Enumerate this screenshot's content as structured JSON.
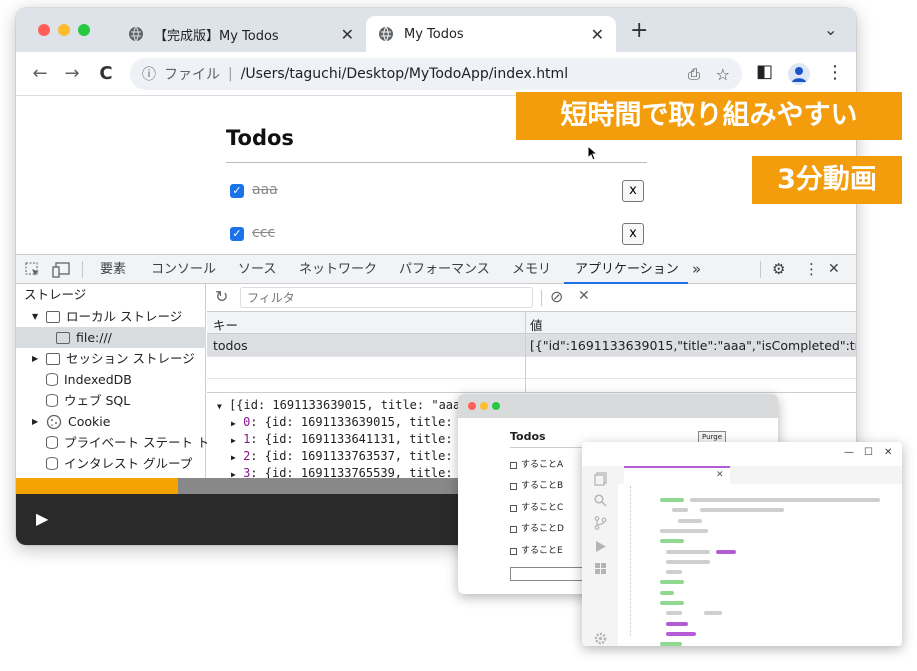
{
  "browser": {
    "tabs": [
      {
        "label": "【完成版】My Todos",
        "close": "✕"
      },
      {
        "label": "My Todos",
        "close": "✕"
      }
    ],
    "new_tab": "+",
    "tab_menu": "⌄",
    "nav": {
      "back": "←",
      "forward": "→",
      "reload": "C"
    },
    "address": {
      "info": "ⓘ",
      "scheme": "ファイル",
      "separator": "|",
      "path": "/Users/taguchi/Desktop/MyTodoApp/index.html"
    },
    "actions": {
      "share": "⎙",
      "bookmark": "☆",
      "sidebar": "◧",
      "menu": "⋮"
    }
  },
  "page": {
    "title": "Todos",
    "todos": [
      {
        "text": "aaa",
        "checked": true,
        "delete": "x"
      },
      {
        "text": "ccc",
        "checked": true,
        "delete": "x"
      }
    ]
  },
  "badges": {
    "headline": "短時間で取り組みやすい",
    "duration": "3分動画",
    "color": "#f39c0c"
  },
  "devtools": {
    "tabs": [
      "要素",
      "コンソール",
      "ソース",
      "ネットワーク",
      "パフォーマンス",
      "メモリ",
      "アプリケーション"
    ],
    "active_tab": "アプリケーション",
    "more": "»",
    "settings": "⚙",
    "kebab": "⋮",
    "close": "✕",
    "sidebar": {
      "header": "ストレージ",
      "items": [
        {
          "label": "ローカル ストレージ",
          "arrow": "▼"
        },
        {
          "label": "file:///",
          "arrow": ""
        },
        {
          "label": "セッション ストレージ",
          "arrow": "▶"
        },
        {
          "label": "IndexedDB",
          "arrow": ""
        },
        {
          "label": "ウェブ SQL",
          "arrow": ""
        },
        {
          "label": "Cookie",
          "arrow": "▶"
        },
        {
          "label": "プライベート ステート ト",
          "arrow": ""
        },
        {
          "label": "インタレスト グループ",
          "arrow": ""
        }
      ]
    },
    "filter": {
      "refresh": "↻",
      "placeholder": "フィルタ",
      "clear_all": "⊘",
      "delete": "✕"
    },
    "table": {
      "headers": [
        "キー",
        "値"
      ],
      "rows": [
        {
          "key": "todos",
          "value": "[{\"id\":1691133639015,\"title\":\"aaa\",\"isCompleted\":tr..."
        }
      ]
    },
    "console": {
      "lines": [
        {
          "arrow": "▼",
          "text": "[{id: 1691133639015, title: \"aaa\""
        },
        {
          "arrow": "▶",
          "index": "0",
          "text": ": {id: 1691133639015, title: \""
        },
        {
          "arrow": "▶",
          "index": "1",
          "text": ": {id: 1691133641131, title: \""
        },
        {
          "arrow": "▶",
          "index": "2",
          "text": ": {id: 1691133763537, title: \""
        },
        {
          "arrow": "▶",
          "index": "3",
          "text": ": {id: 1691133765539, title: \""
        }
      ]
    }
  },
  "player": {
    "play": "▶",
    "progress": 0.193
  },
  "mini_app": {
    "title": "Todos",
    "purge": "Purge",
    "items": [
      "することA",
      "することB",
      "することC",
      "することD",
      "することE"
    ]
  },
  "mini_editor": {
    "controls": {
      "minimize": "—",
      "maximize": "☐",
      "close": "✕"
    },
    "tab_close": "✕"
  }
}
